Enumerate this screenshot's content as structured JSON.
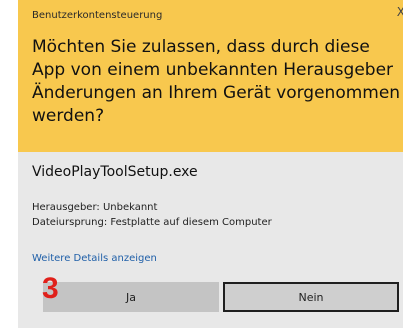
{
  "dialog": {
    "caption": "Benutzerkontensteuerung",
    "close_glyph": "X",
    "question": "Möchten Sie zulassen, dass durch diese App von einem unbekannten Herausgeber Änderungen an Ihrem Gerät vorgenommen werden?",
    "app_name": "VideoPlayToolSetup.exe",
    "publisher": "Herausgeber: Unbekannt",
    "origin": "Dateiursprung: Festplatte auf diesem Computer",
    "details_link": "Weitere Details anzeigen",
    "yes_label": "Ja",
    "no_label": "Nein"
  },
  "annotation": {
    "step_number": "3"
  },
  "colors": {
    "header_background": "#f8c84e",
    "body_background": "#e8e8e8",
    "link": "#1f5fa8",
    "annotation": "#e0201a"
  }
}
